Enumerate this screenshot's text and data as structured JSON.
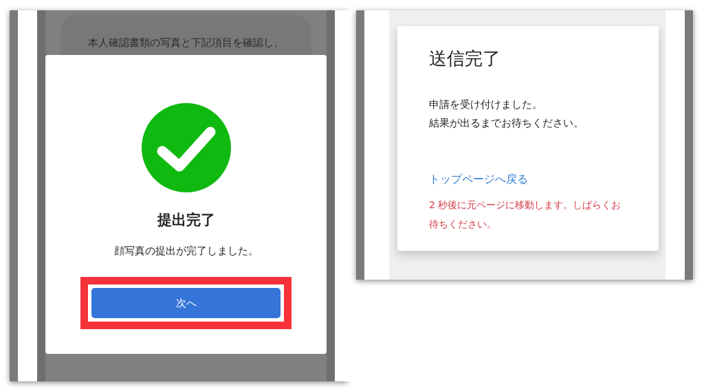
{
  "left_screen": {
    "background_card": {
      "text": "本人確認書類の写真と下記項目を確認し、"
    },
    "modal": {
      "title": "提出完了",
      "message": "顔写真の提出が完了しました。",
      "button": {
        "label": "次へ",
        "highlighted": true
      }
    }
  },
  "right_screen": {
    "card": {
      "title": "送信完了",
      "message_lines": [
        "申請を受け付けました。",
        "結果が出るまでお待ちください。"
      ],
      "link": "トップページへ戻る",
      "notice": "2 秒後に元ページに移動します。しばらくお待ちください。"
    }
  }
}
